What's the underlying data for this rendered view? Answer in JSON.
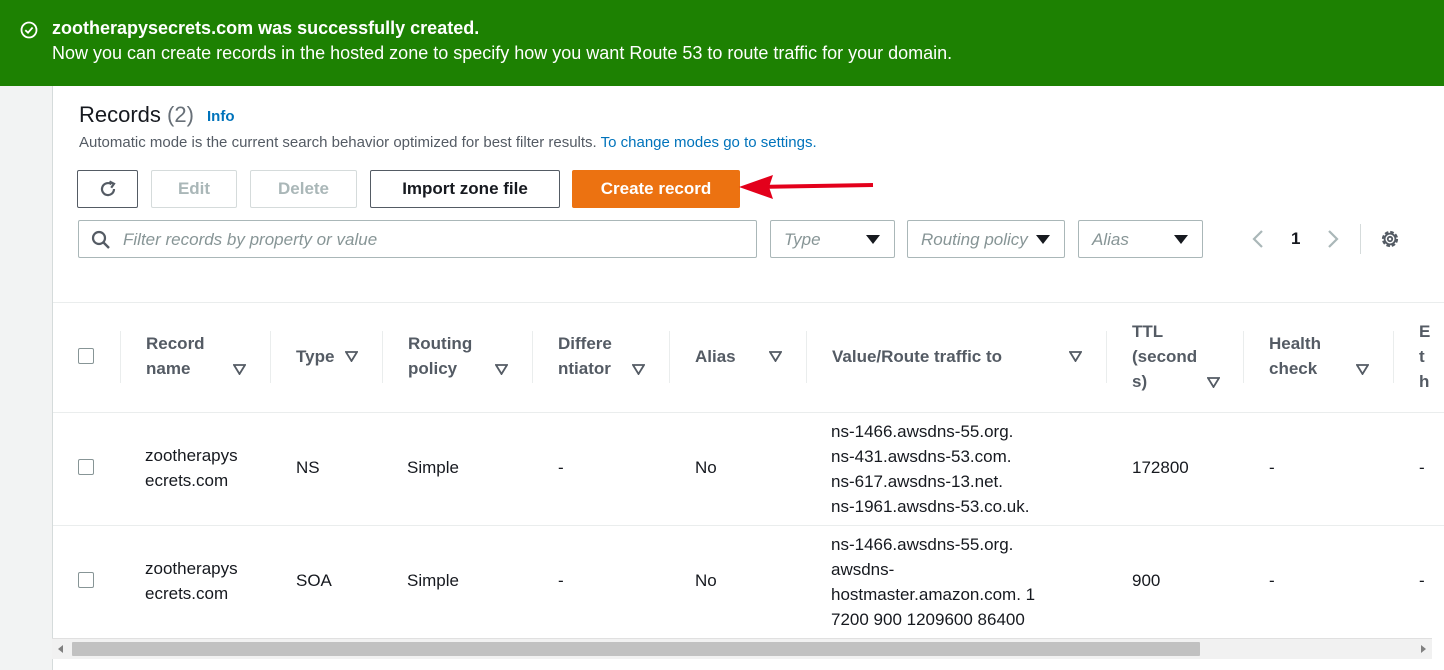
{
  "flash": {
    "title": "zootherapysecrets.com was successfully created.",
    "message": "Now you can create records in the hosted zone to specify how you want Route 53 to route traffic for your domain.",
    "color": "#1d8102",
    "icon": "check-circle-icon"
  },
  "records": {
    "title": "Records",
    "count": "(2)",
    "info": "Info",
    "description": "Automatic mode is the current search behavior optimized for best filter results.",
    "description_link": "To change modes go to settings."
  },
  "toolbar": {
    "refresh_icon": "refresh-icon",
    "edit": "Edit",
    "delete": "Delete",
    "import": "Import zone file",
    "create": "Create record",
    "create_color": "#ec7211"
  },
  "filters": {
    "search_placeholder": "Filter records by property or value",
    "type": "Type",
    "routing_policy": "Routing policy",
    "alias": "Alias"
  },
  "pagination": {
    "page": "1"
  },
  "table": {
    "headers": {
      "record_name": [
        "Record",
        "name"
      ],
      "type": "Type",
      "routing_policy": [
        "Routing",
        "policy"
      ],
      "differentiator": [
        "Differe",
        "ntiator"
      ],
      "alias": "Alias",
      "value": "Value/Route traffic to",
      "ttl": [
        "TTL",
        "(second",
        "s)"
      ],
      "health_check": [
        "Health",
        "check"
      ],
      "cut_off": [
        "E",
        "t",
        "h"
      ]
    },
    "rows": [
      {
        "name": [
          "zootherapys",
          "ecrets.com"
        ],
        "type": "NS",
        "routing_policy": "Simple",
        "differentiator": "-",
        "alias": "No",
        "value": [
          "ns-1466.awsdns-55.org.",
          "ns-431.awsdns-53.com.",
          "ns-617.awsdns-13.net.",
          "ns-1961.awsdns-53.co.uk."
        ],
        "ttl": "172800",
        "health_check": "-",
        "last": "-"
      },
      {
        "name": [
          "zootherapys",
          "ecrets.com"
        ],
        "type": "SOA",
        "routing_policy": "Simple",
        "differentiator": "-",
        "alias": "No",
        "value": [
          "ns-1466.awsdns-55.org.",
          "awsdns-",
          "hostmaster.amazon.com. 1",
          "7200 900 1209600 86400"
        ],
        "ttl": "900",
        "health_check": "-",
        "last": "-"
      }
    ]
  }
}
